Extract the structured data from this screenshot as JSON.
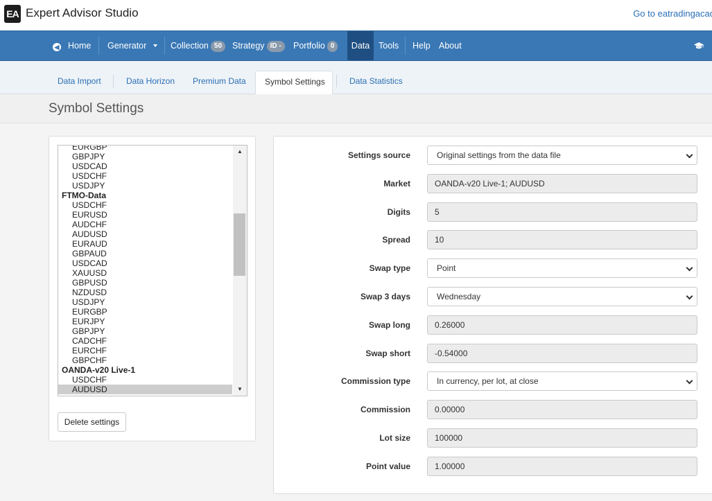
{
  "app": {
    "logo_text": "EA",
    "title": "Expert Advisor Studio",
    "external_link": "Go to eatradingacad"
  },
  "nav": {
    "home": "Home",
    "generator": "Generator",
    "collection": "Collection",
    "collection_badge": "50",
    "strategy": "Strategy",
    "strategy_badge": "ID -",
    "portfolio": "Portfolio",
    "portfolio_badge": "0",
    "data": "Data",
    "tools": "Tools",
    "help": "Help",
    "about": "About",
    "active": "Data"
  },
  "tabs": [
    {
      "label": "Data Import"
    },
    {
      "label": "Data Horizon"
    },
    {
      "label": "Premium Data"
    },
    {
      "label": "Symbol Settings"
    },
    {
      "label": "Data Statistics"
    }
  ],
  "page_title": "Symbol Settings",
  "symbols": {
    "list": [
      {
        "label": "EURGBP",
        "group": false,
        "selected": false
      },
      {
        "label": "GBPJPY",
        "group": false,
        "selected": false
      },
      {
        "label": "USDCAD",
        "group": false,
        "selected": false
      },
      {
        "label": "USDCHF",
        "group": false,
        "selected": false
      },
      {
        "label": "USDJPY",
        "group": false,
        "selected": false
      },
      {
        "label": "FTMO-Data",
        "group": true,
        "selected": false
      },
      {
        "label": "USDCHF",
        "group": false,
        "selected": false
      },
      {
        "label": "EURUSD",
        "group": false,
        "selected": false
      },
      {
        "label": "AUDCHF",
        "group": false,
        "selected": false
      },
      {
        "label": "AUDUSD",
        "group": false,
        "selected": false
      },
      {
        "label": "EURAUD",
        "group": false,
        "selected": false
      },
      {
        "label": "GBPAUD",
        "group": false,
        "selected": false
      },
      {
        "label": "USDCAD",
        "group": false,
        "selected": false
      },
      {
        "label": "XAUUSD",
        "group": false,
        "selected": false
      },
      {
        "label": "GBPUSD",
        "group": false,
        "selected": false
      },
      {
        "label": "NZDUSD",
        "group": false,
        "selected": false
      },
      {
        "label": "USDJPY",
        "group": false,
        "selected": false
      },
      {
        "label": "EURGBP",
        "group": false,
        "selected": false
      },
      {
        "label": "EURJPY",
        "group": false,
        "selected": false
      },
      {
        "label": "GBPJPY",
        "group": false,
        "selected": false
      },
      {
        "label": "CADCHF",
        "group": false,
        "selected": false
      },
      {
        "label": "EURCHF",
        "group": false,
        "selected": false
      },
      {
        "label": "GBPCHF",
        "group": false,
        "selected": false
      },
      {
        "label": "OANDA-v20 Live-1",
        "group": true,
        "selected": false
      },
      {
        "label": "USDCHF",
        "group": false,
        "selected": false
      },
      {
        "label": "AUDUSD",
        "group": false,
        "selected": true
      }
    ],
    "delete_label": "Delete settings"
  },
  "settings": [
    {
      "label": "Settings source",
      "value": "Original settings from the data file",
      "kind": "select"
    },
    {
      "label": "Market",
      "value": "OANDA-v20 Live-1; AUDUSD",
      "kind": "readonly"
    },
    {
      "label": "Digits",
      "value": "5",
      "kind": "readonly"
    },
    {
      "label": "Spread",
      "value": "10",
      "kind": "readonly"
    },
    {
      "label": "Swap type",
      "value": "Point",
      "kind": "select"
    },
    {
      "label": "Swap 3 days",
      "value": "Wednesday",
      "kind": "select"
    },
    {
      "label": "Swap long",
      "value": "0.26000",
      "kind": "readonly"
    },
    {
      "label": "Swap short",
      "value": "-0.54000",
      "kind": "readonly"
    },
    {
      "label": "Commission type",
      "value": "In currency, per lot, at close",
      "kind": "select"
    },
    {
      "label": "Commission",
      "value": "0.00000",
      "kind": "readonly"
    },
    {
      "label": "Lot size",
      "value": "100000",
      "kind": "readonly"
    },
    {
      "label": "Point value",
      "value": "1.00000",
      "kind": "readonly"
    }
  ],
  "colors": {
    "navbar": "#3a78b5",
    "navbar_active": "#1f4f82",
    "link": "#2a6fb5"
  }
}
